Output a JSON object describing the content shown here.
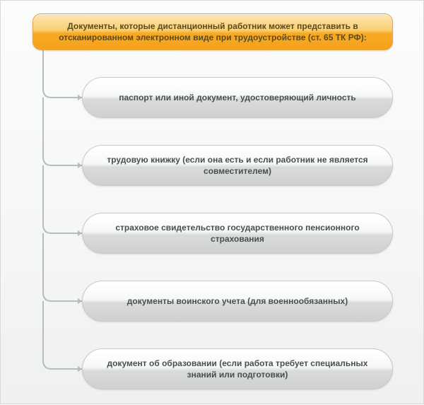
{
  "header": {
    "title": "Документы, которые дистанционный работник может представить в отсканированном электронном виде при трудоустройстве (ст. 65 ТК РФ):"
  },
  "items": [
    {
      "label": "паспорт или иной документ, удостоверяющий личность"
    },
    {
      "label": "трудовую книжку (если она есть и если работник не является совместителем)"
    },
    {
      "label": "страховое свидетельство государственного пенсионного страхования"
    },
    {
      "label": "документы воинского учета (для военнообязанных)"
    },
    {
      "label": "документ об образовании (если работа требует специальных знаний или подготовки)"
    }
  ],
  "layout": {
    "itemTops": [
      108,
      204,
      300,
      396,
      492
    ]
  },
  "style": {
    "connectorColor": "#b9bcbd"
  }
}
